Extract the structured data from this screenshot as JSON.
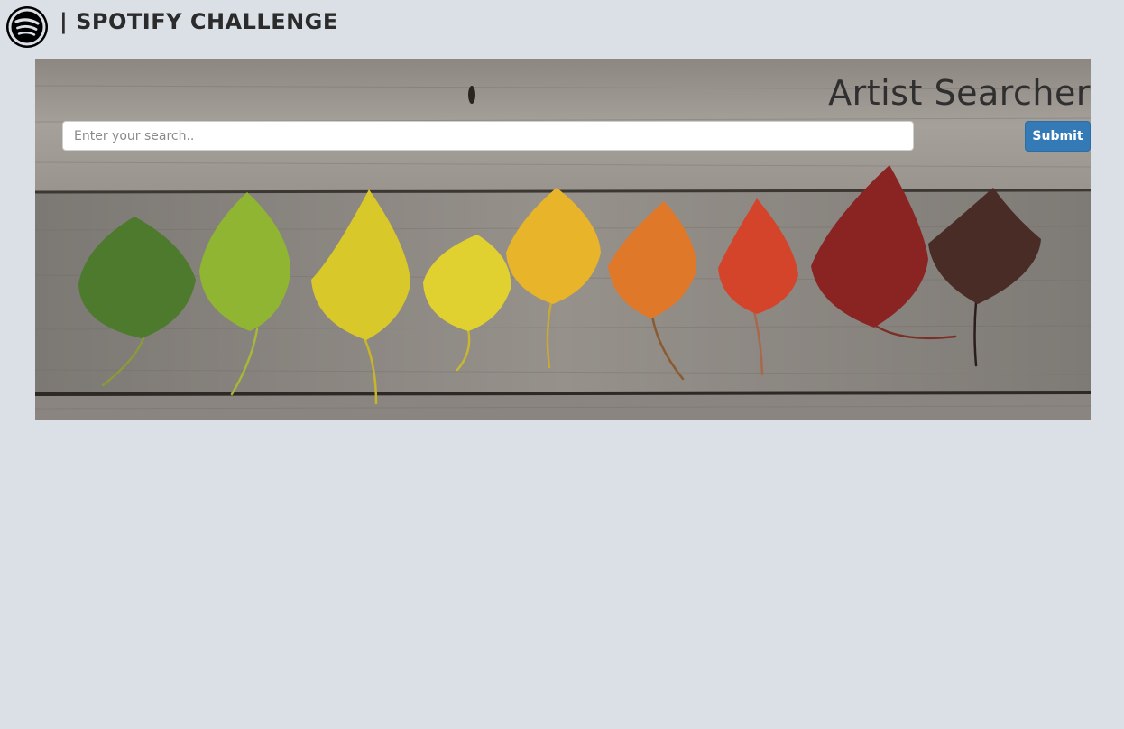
{
  "brand": {
    "logo_icon": "spotify-logo-icon",
    "title": "| SPOTIFY CHALLENGE"
  },
  "hero": {
    "title": "Artist Searcher",
    "background": "wooden-planks-with-autumn-leaves",
    "search": {
      "placeholder": "Enter your search..",
      "value": ""
    },
    "submit_label": "Submit"
  },
  "colors": {
    "page_background": "#dae0e6",
    "button": "#337ab7",
    "text": "#2b2b2b"
  }
}
